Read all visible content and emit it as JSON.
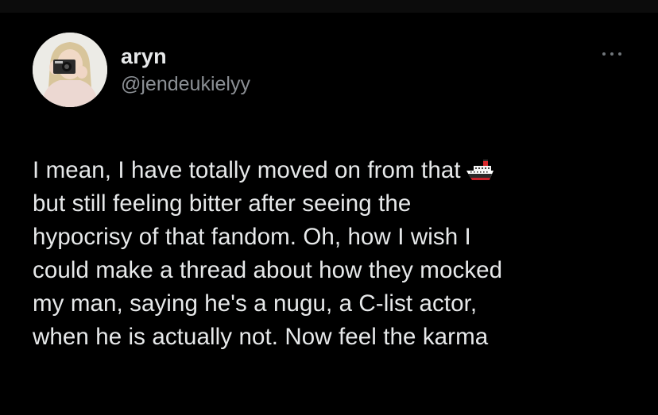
{
  "author": {
    "display_name": "aryn",
    "handle": "@jendeukielyy",
    "avatar_icon": "profile-photo-person-with-camera"
  },
  "menu": {
    "icon": "more-options-icon"
  },
  "tweet": {
    "lines": [
      "I mean, I have totally moved on from that",
      "but still feeling bitter after seeing the",
      "hypocrisy of that fandom. Oh, how I wish I",
      "could make a thread about how they mocked",
      "my man, saying he's a nugu, a C-list actor,",
      "when he is actually not. Now feel the karma"
    ],
    "emoji": "ship-icon"
  },
  "colors": {
    "background": "#000000",
    "text_primary": "#e7e9ea",
    "text_secondary": "#8b8f94",
    "icon_muted": "#71767b"
  }
}
